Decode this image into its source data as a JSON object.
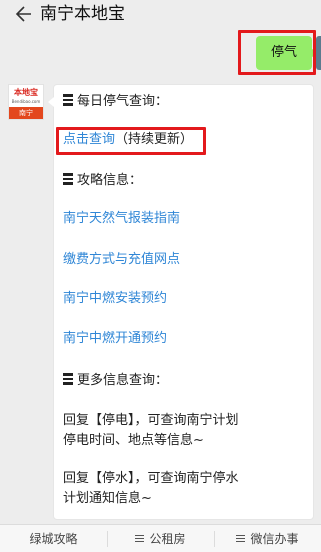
{
  "header": {
    "title": "南宁本地宝"
  },
  "outgoing_message": {
    "text": "停气"
  },
  "account_avatar": {
    "top_text": "本地宝",
    "sub_text": "Bendibao.com",
    "bottom_text": "南宁"
  },
  "incoming_message": {
    "daily_heading": "每日停气查询：",
    "daily_link": "点击查询",
    "daily_note": "（持续更新）",
    "guide_heading": "攻略信息：",
    "guide_links": [
      "南宁天然气报装指南",
      "缴费方式与充值网点",
      "南宁中燃安装预约",
      "南宁中燃开通预约"
    ],
    "more_heading": "更多信息查询：",
    "reply_power_line1": "回复【停电】，可查询南宁计划",
    "reply_power_line2": "停电时间、地点等信息~",
    "reply_water_line1": "回复【停水】，可查询南宁停水",
    "reply_water_line2": "计划通知信息~"
  },
  "bottom_menu": {
    "items": [
      {
        "label": "绿城攻略"
      },
      {
        "label": "公租房"
      },
      {
        "label": "微信办事"
      }
    ]
  },
  "colors": {
    "link": "#2f86d6",
    "outgoing_bubble": "#95ec69",
    "highlight_box": "#e3191c",
    "background": "#ededed"
  }
}
